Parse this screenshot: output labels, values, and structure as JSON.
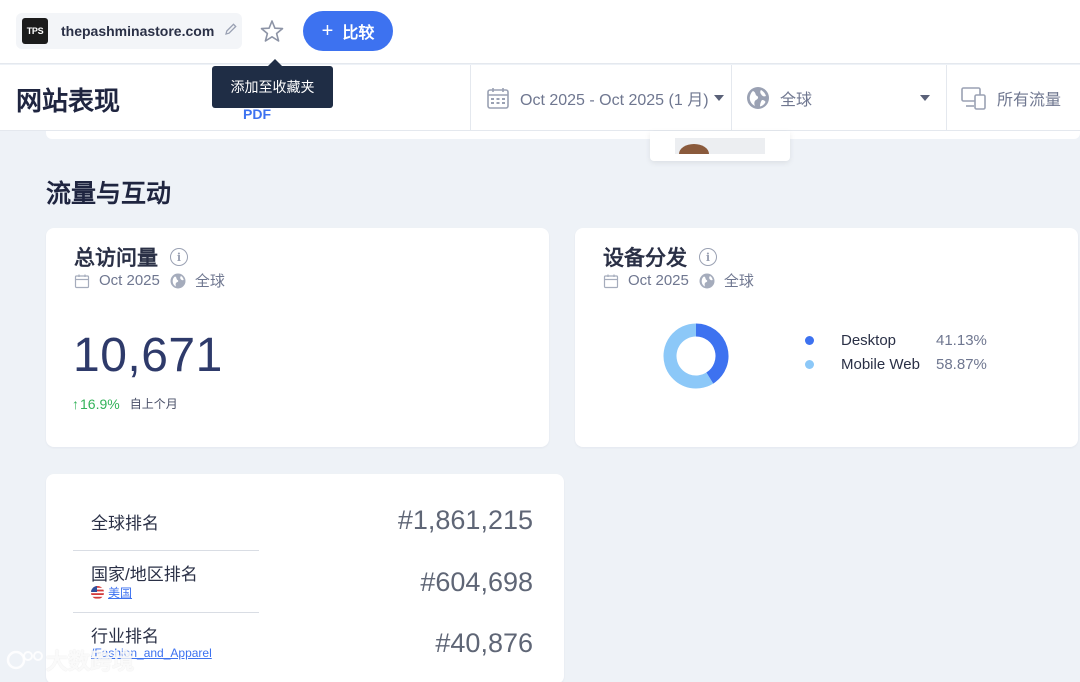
{
  "topbar": {
    "favicon_text": "TPS",
    "site_name": "thepashminastore.com",
    "compare_label": "比较"
  },
  "tooltip": {
    "text": "添加至收藏夹"
  },
  "header": {
    "title": "网站表现",
    "pdf_label": "PDF",
    "date_filter": "Oct 2025 - Oct 2025 (1 月)",
    "geo_filter": "全球",
    "traffic_filter": "所有流量"
  },
  "section": {
    "title": "流量与互动"
  },
  "visits_card": {
    "title": "总访问量",
    "date": "Oct 2025",
    "geo": "全球",
    "value": "10,671",
    "change_arrow": "↑",
    "change_pct": "16.9%",
    "change_period": "自上个月"
  },
  "device_card": {
    "title": "设备分发",
    "date": "Oct 2025",
    "geo": "全球",
    "segments": [
      {
        "name": "Desktop",
        "label": "41.13%",
        "value": 41.13,
        "color": "#3d72f0"
      },
      {
        "name": "Mobile Web",
        "label": "58.87%",
        "value": 58.87,
        "color": "#8cc8f8"
      }
    ]
  },
  "rank_card": {
    "global_label": "全球排名",
    "global_value": "#1,861,215",
    "country_label": "国家/地区排名",
    "country_name": "美国",
    "country_value": "#604,698",
    "industry_label": "行业排名",
    "industry_name": "/Fashion_and_Apparel",
    "industry_value": "#40,876"
  },
  "watermark": {
    "text": "大数跨境"
  },
  "icons": [
    "pencil-icon",
    "star-icon",
    "plus-icon",
    "calendar-icon",
    "globe-icon",
    "devices-icon",
    "info-icon",
    "us-flag-icon"
  ]
}
